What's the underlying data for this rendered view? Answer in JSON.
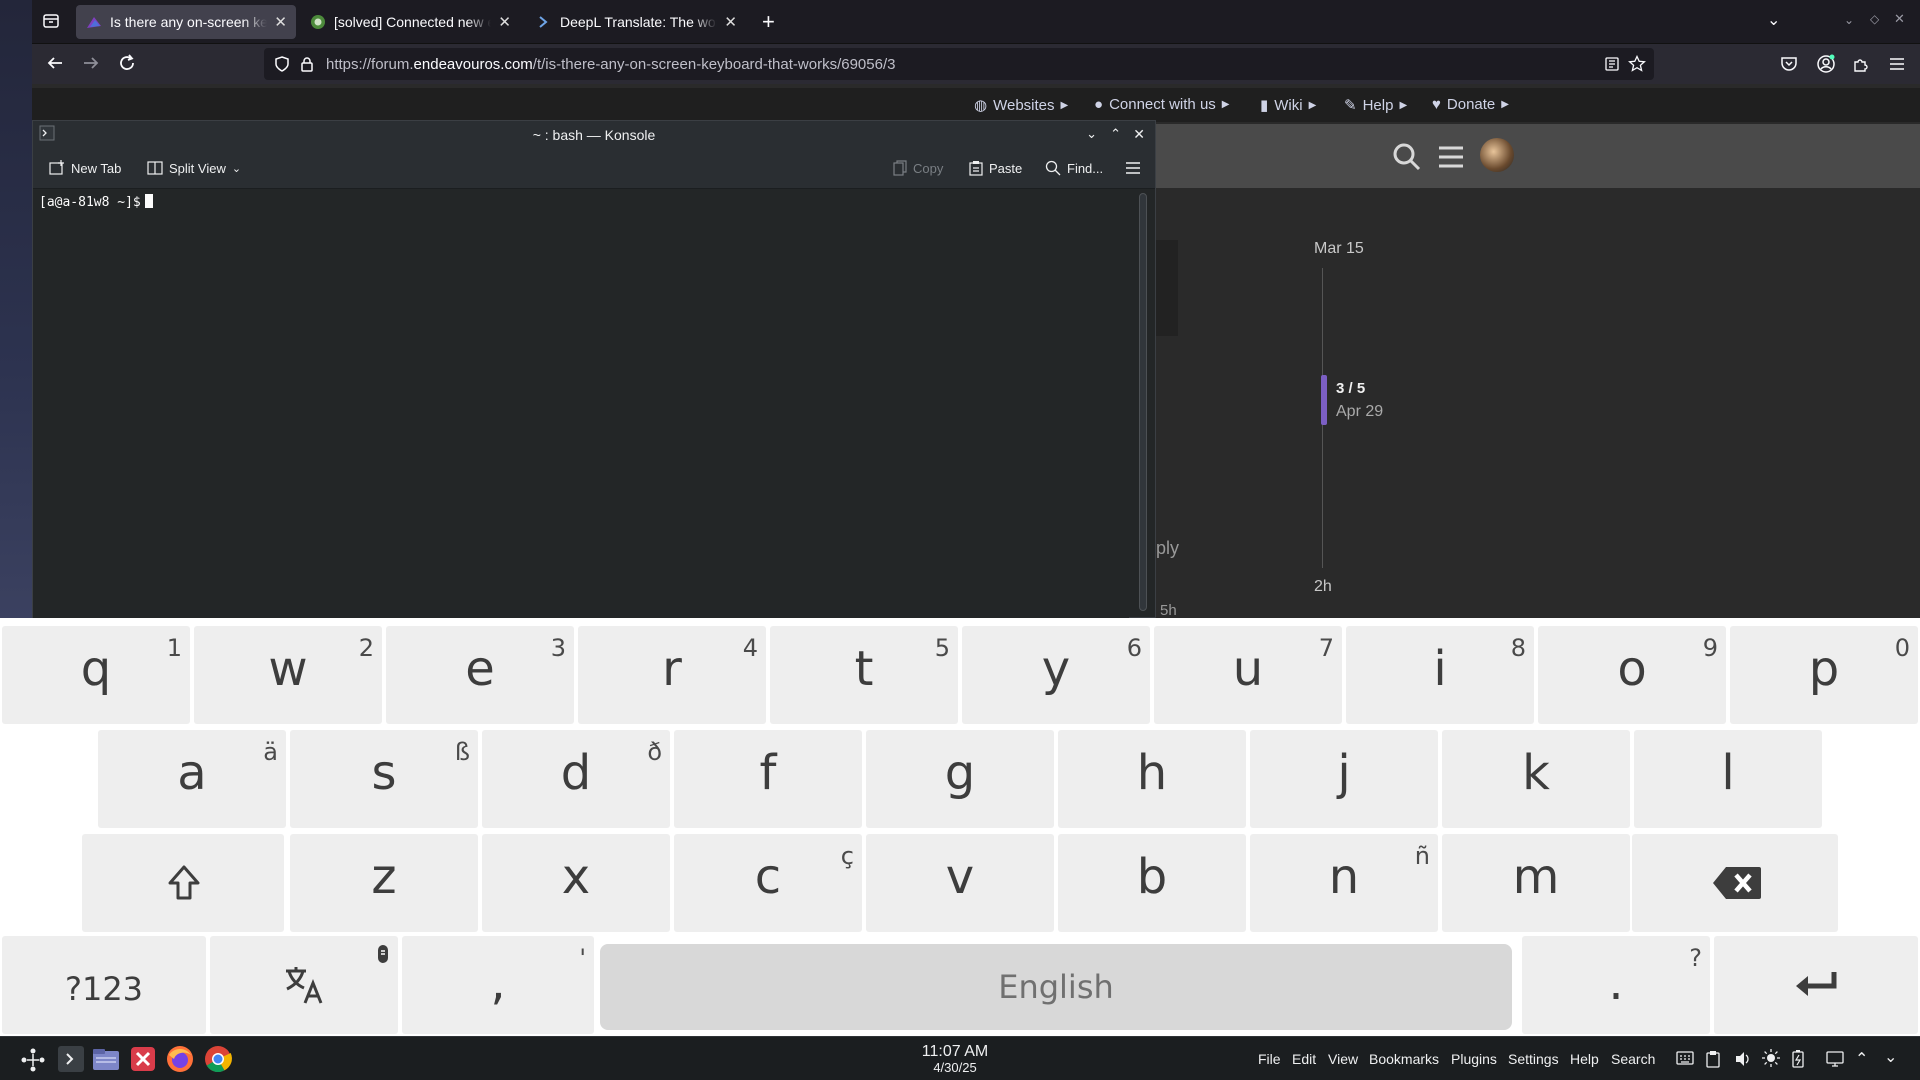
{
  "browser": {
    "tabs": [
      {
        "title": "Is there any on-screen keyboard that works",
        "active": true
      },
      {
        "title": "[solved] Connected new external display",
        "active": false
      },
      {
        "title": "DeepL Translate: The world's most accurate translator",
        "active": false
      }
    ],
    "url": {
      "prefix": "https://forum.",
      "domain": "endeavouros.com",
      "path": "/t/is-there-any-on-screen-keyboard-that-works/69056/3"
    }
  },
  "forum": {
    "links": [
      "Websites",
      "Connect with us",
      "Wiki",
      "Help",
      "Donate"
    ],
    "timeline": {
      "start_date": "Mar 15",
      "position": "3 / 5",
      "position_date": "Apr 29",
      "end_label": "2h"
    },
    "reply_fragment": "ply",
    "age_fragment": "5h"
  },
  "konsole": {
    "title": "~ : bash — Konsole",
    "toolbar": {
      "new_tab": "New Tab",
      "split_view": "Split View",
      "copy": "Copy",
      "paste": "Paste",
      "find": "Find..."
    },
    "prompt": "[a@a-81w8 ~]$"
  },
  "keyboard": {
    "row1": [
      {
        "main": "q",
        "hint": "1"
      },
      {
        "main": "w",
        "hint": "2"
      },
      {
        "main": "e",
        "hint": "3"
      },
      {
        "main": "r",
        "hint": "4"
      },
      {
        "main": "t",
        "hint": "5"
      },
      {
        "main": "y",
        "hint": "6"
      },
      {
        "main": "u",
        "hint": "7"
      },
      {
        "main": "i",
        "hint": "8"
      },
      {
        "main": "o",
        "hint": "9"
      },
      {
        "main": "p",
        "hint": "0"
      }
    ],
    "row2": [
      {
        "main": "a",
        "hint": "ä"
      },
      {
        "main": "s",
        "hint": "ß"
      },
      {
        "main": "d",
        "hint": "ð"
      },
      {
        "main": "f",
        "hint": ""
      },
      {
        "main": "g",
        "hint": ""
      },
      {
        "main": "h",
        "hint": ""
      },
      {
        "main": "j",
        "hint": ""
      },
      {
        "main": "k",
        "hint": ""
      },
      {
        "main": "l",
        "hint": ""
      }
    ],
    "row3": [
      {
        "main": "z",
        "hint": ""
      },
      {
        "main": "x",
        "hint": ""
      },
      {
        "main": "c",
        "hint": "ç"
      },
      {
        "main": "v",
        "hint": ""
      },
      {
        "main": "b",
        "hint": ""
      },
      {
        "main": "n",
        "hint": "ñ"
      },
      {
        "main": "m",
        "hint": ""
      }
    ],
    "symbols_label": "?123",
    "comma": {
      "main": ",",
      "hint": "'"
    },
    "space_label": "English",
    "period": {
      "main": ".",
      "hint": "?"
    }
  },
  "taskbar": {
    "time": "11:07 AM",
    "date": "4/30/25",
    "menus": [
      "File",
      "Edit",
      "View",
      "Bookmarks",
      "Plugins",
      "Settings",
      "Help",
      "Search"
    ]
  }
}
